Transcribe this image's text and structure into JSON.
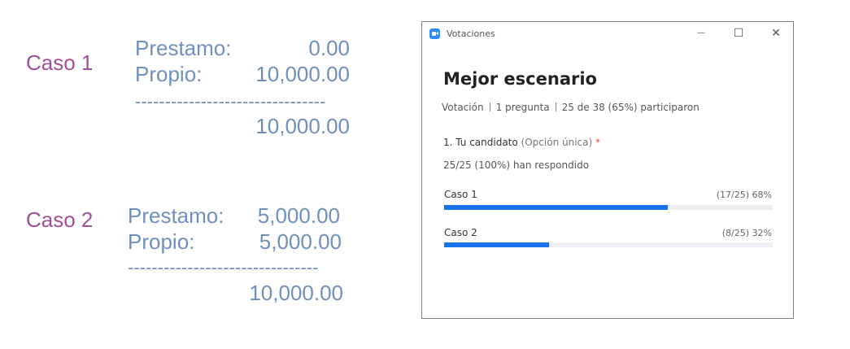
{
  "slide": {
    "case1": {
      "label": "Caso 1",
      "prestamo_label": "Prestamo:",
      "prestamo_value": "0.00",
      "propio_label": "Propio:",
      "propio_value": "10,000.00",
      "divider": "--------------------------------",
      "total": "10,000.00"
    },
    "case2": {
      "label": "Caso 2",
      "prestamo_label": "Prestamo:",
      "prestamo_value": "5,000.00",
      "propio_label": "Propio:",
      "propio_value": "5,000.00",
      "divider": "--------------------------------",
      "total": "10,000.00"
    }
  },
  "window": {
    "title": "Votaciones",
    "icon": "zoom-video-icon",
    "controls": {
      "minimize": "—",
      "maximize": "☐",
      "close": "✕"
    }
  },
  "poll": {
    "title": "Mejor escenario",
    "meta": {
      "type": "Votación",
      "questions": "1 pregunta",
      "participation": "25 de 38 (65%) participaron"
    },
    "question": {
      "text": "1. Tu candidato",
      "type": "(Opción única)",
      "required_mark": "*"
    },
    "answered": "25/25 (100%) han respondido",
    "options": [
      {
        "label": "Caso 1",
        "stat": "(17/25) 68%",
        "fraction": 0.68
      },
      {
        "label": "Caso 2",
        "stat": "(8/25) 32%",
        "fraction": 0.32
      }
    ],
    "colors": {
      "accent": "#1a73e8",
      "track": "#efeff3",
      "required": "#e0453e"
    }
  }
}
